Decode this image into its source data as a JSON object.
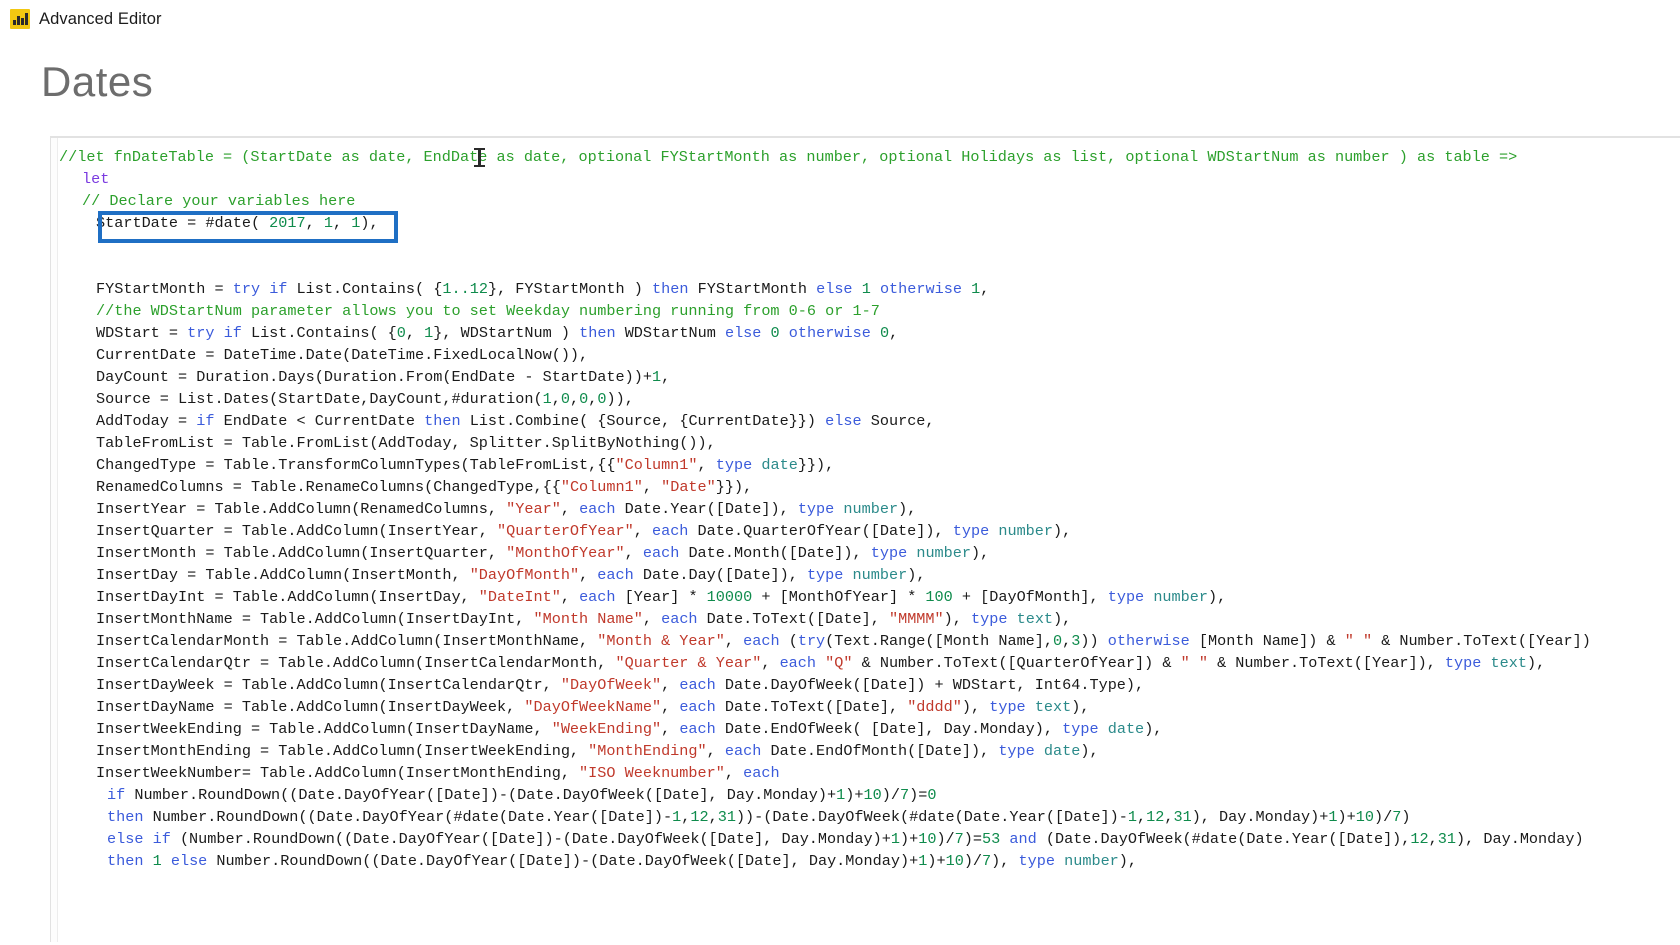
{
  "window": {
    "title": "Advanced Editor",
    "icon": "power-bi-icon"
  },
  "heading": "Dates",
  "highlight": {
    "color": "#1f6fc4",
    "target_line": "StartDate = #date( 2017, 1, 1),"
  },
  "code": {
    "language": "Power Query M",
    "lines": [
      {
        "id": "l1",
        "indent": 0,
        "text": "//let fnDateTable = (StartDate as date, EndDate as date, optional FYStartMonth as number, optional Holidays as list, optional WDStartNum as number ) as table =>"
      },
      {
        "id": "l2",
        "indent": 1,
        "text": "let"
      },
      {
        "id": "l3",
        "indent": 1,
        "text": "// Declare your variables here"
      },
      {
        "id": "l4",
        "indent": 2,
        "text": "StartDate = #date( 2017, 1, 1),"
      },
      {
        "id": "l5",
        "indent": 0,
        "text": ""
      },
      {
        "id": "l6",
        "indent": 0,
        "text": ""
      },
      {
        "id": "l7",
        "indent": 2,
        "text": "FYStartMonth = try if List.Contains( {1..12}, FYStartMonth ) then FYStartMonth else 1 otherwise 1,"
      },
      {
        "id": "l8",
        "indent": 2,
        "text": "//the WDStartNum parameter allows you to set Weekday numbering running from 0-6 or 1-7"
      },
      {
        "id": "l9",
        "indent": 2,
        "text": "WDStart = try if List.Contains( {0, 1}, WDStartNum ) then WDStartNum else 0 otherwise 0,"
      },
      {
        "id": "l10",
        "indent": 2,
        "text": "CurrentDate = DateTime.Date(DateTime.FixedLocalNow()),"
      },
      {
        "id": "l11",
        "indent": 2,
        "text": "DayCount = Duration.Days(Duration.From(EndDate - StartDate))+1,"
      },
      {
        "id": "l12",
        "indent": 2,
        "text": "Source = List.Dates(StartDate,DayCount,#duration(1,0,0,0)),"
      },
      {
        "id": "l13",
        "indent": 2,
        "text": "AddToday = if EndDate < CurrentDate then List.Combine( {Source, {CurrentDate}}) else Source,"
      },
      {
        "id": "l14",
        "indent": 2,
        "text": "TableFromList = Table.FromList(AddToday, Splitter.SplitByNothing()),"
      },
      {
        "id": "l15",
        "indent": 2,
        "text": "ChangedType = Table.TransformColumnTypes(TableFromList,{{\"Column1\", type date}}),"
      },
      {
        "id": "l16",
        "indent": 2,
        "text": "RenamedColumns = Table.RenameColumns(ChangedType,{{\"Column1\", \"Date\"}}),"
      },
      {
        "id": "l17",
        "indent": 2,
        "text": "InsertYear = Table.AddColumn(RenamedColumns, \"Year\", each Date.Year([Date]), type number),"
      },
      {
        "id": "l18",
        "indent": 2,
        "text": "InsertQuarter = Table.AddColumn(InsertYear, \"QuarterOfYear\", each Date.QuarterOfYear([Date]), type number),"
      },
      {
        "id": "l19",
        "indent": 2,
        "text": "InsertMonth = Table.AddColumn(InsertQuarter, \"MonthOfYear\", each Date.Month([Date]), type number),"
      },
      {
        "id": "l20",
        "indent": 2,
        "text": "InsertDay = Table.AddColumn(InsertMonth, \"DayOfMonth\", each Date.Day([Date]), type number),"
      },
      {
        "id": "l21",
        "indent": 2,
        "text": "InsertDayInt = Table.AddColumn(InsertDay, \"DateInt\", each [Year] * 10000 + [MonthOfYear] * 100 + [DayOfMonth], type number),"
      },
      {
        "id": "l22",
        "indent": 2,
        "text": "InsertMonthName = Table.AddColumn(InsertDayInt, \"Month Name\", each Date.ToText([Date], \"MMMM\"), type text),"
      },
      {
        "id": "l23",
        "indent": 2,
        "text": "InsertCalendarMonth = Table.AddColumn(InsertMonthName, \"Month & Year\", each (try(Text.Range([Month Name],0,3)) otherwise [Month Name]) & \" \" & Number.ToText([Year])"
      },
      {
        "id": "l24",
        "indent": 2,
        "text": "InsertCalendarQtr = Table.AddColumn(InsertCalendarMonth, \"Quarter & Year\", each \"Q\" & Number.ToText([QuarterOfYear]) & \" \" & Number.ToText([Year]), type text),"
      },
      {
        "id": "l25",
        "indent": 2,
        "text": "InsertDayWeek = Table.AddColumn(InsertCalendarQtr, \"DayOfWeek\", each Date.DayOfWeek([Date]) + WDStart, Int64.Type),"
      },
      {
        "id": "l26",
        "indent": 2,
        "text": "InsertDayName = Table.AddColumn(InsertDayWeek, \"DayOfWeekName\", each Date.ToText([Date], \"dddd\"), type text),"
      },
      {
        "id": "l27",
        "indent": 2,
        "text": "InsertWeekEnding = Table.AddColumn(InsertDayName, \"WeekEnding\", each Date.EndOfWeek( [Date], Day.Monday), type date),"
      },
      {
        "id": "l28",
        "indent": 2,
        "text": "InsertMonthEnding = Table.AddColumn(InsertWeekEnding, \"MonthEnding\", each Date.EndOfMonth([Date]), type date),"
      },
      {
        "id": "l29",
        "indent": 2,
        "text": "InsertWeekNumber= Table.AddColumn(InsertMonthEnding, \"ISO Weeknumber\", each"
      },
      {
        "id": "l30",
        "indent": 3,
        "text": "if Number.RoundDown((Date.DayOfYear([Date])-(Date.DayOfWeek([Date], Day.Monday)+1)+10)/7)=0"
      },
      {
        "id": "l31",
        "indent": 3,
        "text": "then Number.RoundDown((Date.DayOfYear(#date(Date.Year([Date])-1,12,31))-(Date.DayOfWeek(#date(Date.Year([Date])-1,12,31), Day.Monday)+1)+10)/7)"
      },
      {
        "id": "l32",
        "indent": 3,
        "text": "else if (Number.RoundDown((Date.DayOfYear([Date])-(Date.DayOfWeek([Date], Day.Monday)+1)+10)/7)=53 and (Date.DayOfWeek(#date(Date.Year([Date]),12,31), Day.Monday)"
      },
      {
        "id": "l33",
        "indent": 3,
        "text": "then 1 else Number.RoundDown((Date.DayOfYear([Date])-(Date.DayOfWeek([Date], Day.Monday)+1)+10)/7), type number),"
      }
    ]
  },
  "colors": {
    "comment": "#2ca02c",
    "keyword": "#3b5bdb",
    "string": "#c0392b",
    "number": "#0f8b4c",
    "type": "#2b8a8a",
    "accent": "#f2c811",
    "highlight_box": "#1f6fc4"
  }
}
